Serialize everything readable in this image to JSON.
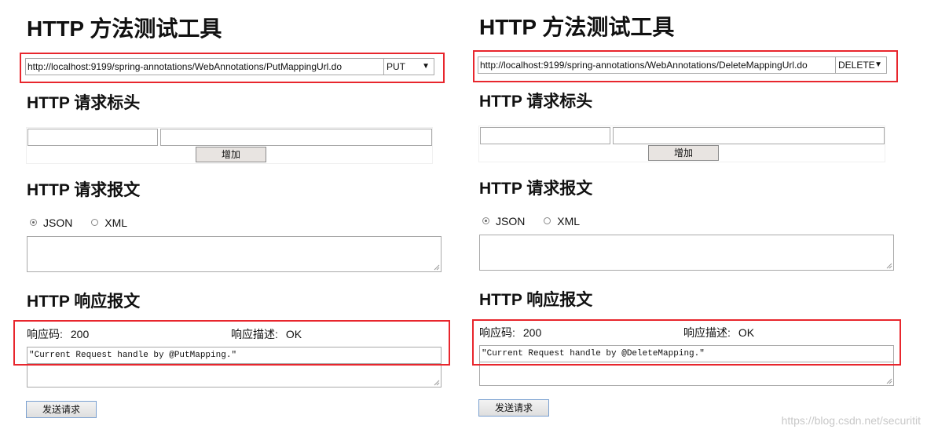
{
  "left": {
    "title": "HTTP 方法测试工具",
    "url": "http://localhost:9199/spring-annotations/WebAnnotations/PutMappingUrl.do",
    "method": "PUT",
    "headers_section": "HTTP 请求标头",
    "add_label": "增加",
    "body_section": "HTTP 请求报文",
    "radio_json": "JSON",
    "radio_xml": "XML",
    "response_section": "HTTP 响应报文",
    "code_label": "响应码:",
    "code_value": "200",
    "desc_label": "响应描述:",
    "desc_value": "OK",
    "response_body": "\"Current Request handle by @PutMapping.\"",
    "send_label": "发送请求"
  },
  "right": {
    "title": "HTTP 方法测试工具",
    "url": "http://localhost:9199/spring-annotations/WebAnnotations/DeleteMappingUrl.do",
    "method": "DELETE",
    "headers_section": "HTTP 请求标头",
    "add_label": "增加",
    "body_section": "HTTP 请求报文",
    "radio_json": "JSON",
    "radio_xml": "XML",
    "response_section": "HTTP 响应报文",
    "code_label": "响应码:",
    "code_value": "200",
    "desc_label": "响应描述:",
    "desc_value": "OK",
    "response_body": "\"Current Request handle by @DeleteMapping.\"",
    "send_label": "发送请求"
  },
  "watermark": "https://blog.csdn.net/securitit",
  "colors": {
    "highlight": "#e8262d"
  }
}
